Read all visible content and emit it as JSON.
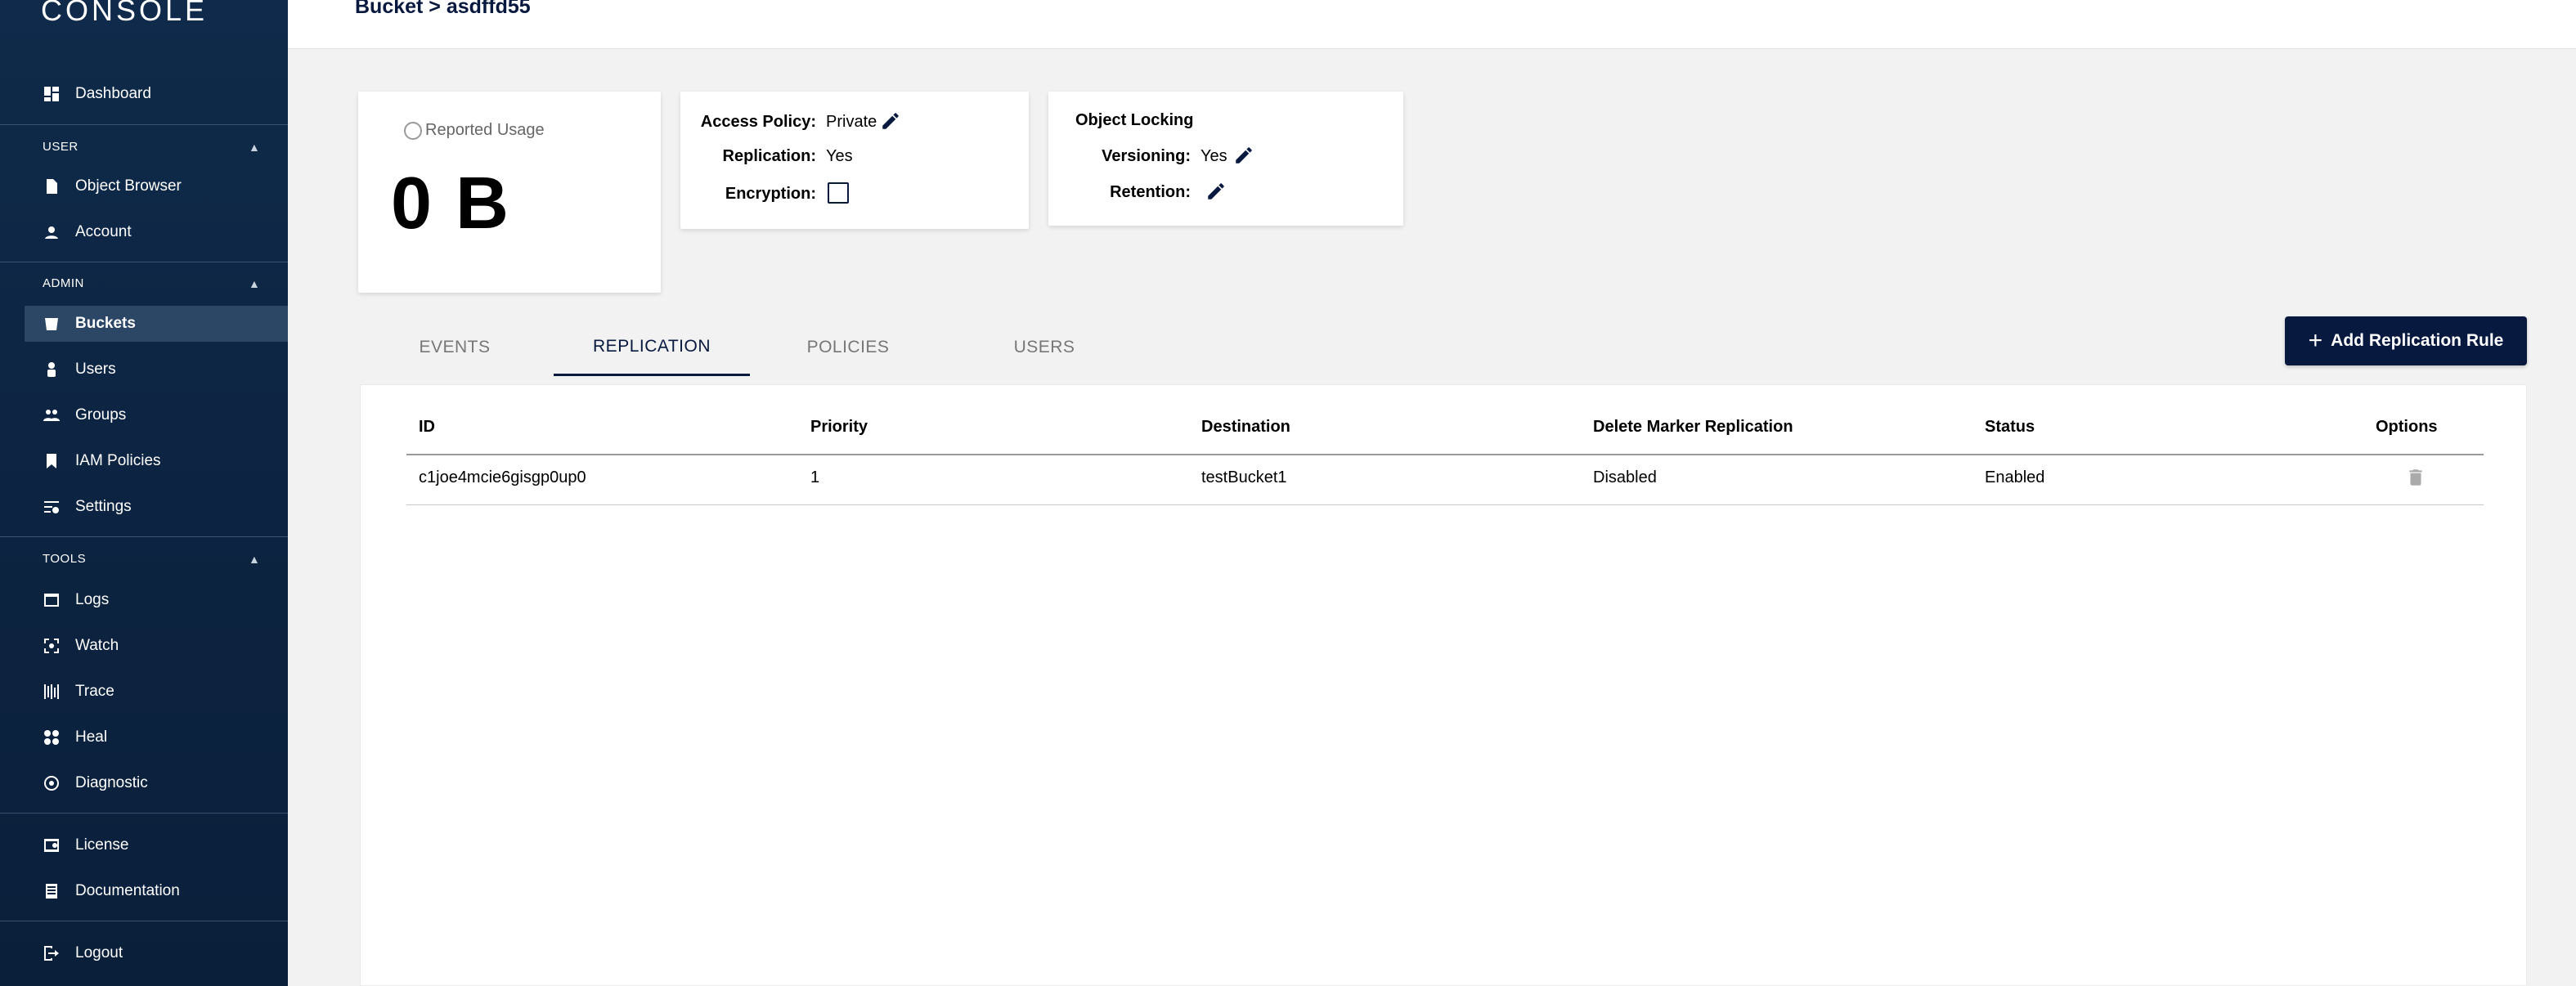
{
  "app": {
    "brand": "CONSOLE"
  },
  "sidebar": {
    "dashboard": "Dashboard",
    "sections": {
      "user": "USER",
      "admin": "ADMIN",
      "tools": "TOOLS"
    },
    "user_items": [
      "Object Browser",
      "Account"
    ],
    "admin_items": [
      "Buckets",
      "Users",
      "Groups",
      "IAM Policies",
      "Settings"
    ],
    "tools_items": [
      "Logs",
      "Watch",
      "Trace",
      "Heal",
      "Diagnostic"
    ],
    "bottom_items": [
      "License",
      "Documentation"
    ],
    "logout": "Logout"
  },
  "header": {
    "breadcrumb": "Bucket > asdffd55"
  },
  "usage": {
    "title": "Reported Usage",
    "value": "0 B"
  },
  "access": {
    "policy_label": "Access Policy:",
    "policy_value": "Private",
    "replication_label": "Replication:",
    "replication_value": "Yes",
    "encryption_label": "Encryption:"
  },
  "locking": {
    "title": "Object Locking",
    "versioning_label": "Versioning:",
    "versioning_value": "Yes",
    "retention_label": "Retention:"
  },
  "tabs": [
    "EVENTS",
    "REPLICATION",
    "POLICIES",
    "USERS"
  ],
  "actions": {
    "add_rule": "Add Replication Rule"
  },
  "table": {
    "headers": [
      "ID",
      "Priority",
      "Destination",
      "Delete Marker Replication",
      "Status",
      "Options"
    ],
    "rows": [
      [
        "c1joe4mcie6gisgp0up0",
        "1",
        "testBucket1",
        "Disabled",
        "Enabled"
      ]
    ]
  },
  "colors": {
    "primary": "#07193e",
    "sidebar": "#0c2340",
    "background": "#f2f2f2"
  }
}
